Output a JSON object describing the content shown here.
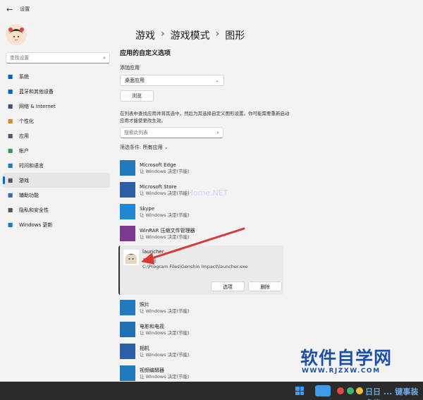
{
  "window": {
    "title": "设置",
    "back_glyph": "←"
  },
  "sidebar": {
    "search_placeholder": "查找设置",
    "items": [
      {
        "label": "系统",
        "icon": "monitor-icon",
        "color": "#0067c0"
      },
      {
        "label": "蓝牙和其他设备",
        "icon": "bluetooth-icon",
        "color": "#0067c0"
      },
      {
        "label": "网络 & Internet",
        "icon": "network-icon",
        "color": "#3b4e7a"
      },
      {
        "label": "个性化",
        "icon": "brush-icon",
        "color": "#d9822b"
      },
      {
        "label": "应用",
        "icon": "apps-icon",
        "color": "#4a5a70"
      },
      {
        "label": "帐户",
        "icon": "account-icon",
        "color": "#2e9a5c"
      },
      {
        "label": "时间和语言",
        "icon": "globe-clock-icon",
        "color": "#1f7ac0"
      },
      {
        "label": "游戏",
        "icon": "gamepad-icon",
        "color": "#555555",
        "active": true
      },
      {
        "label": "辅助功能",
        "icon": "accessibility-icon",
        "color": "#2f6fb0"
      },
      {
        "label": "隐私和安全性",
        "icon": "shield-icon",
        "color": "#555555"
      },
      {
        "label": "Windows 更新",
        "icon": "update-icon",
        "color": "#1f7ac0"
      }
    ]
  },
  "breadcrumb": [
    "游戏",
    "游戏模式",
    "图形"
  ],
  "main": {
    "section_title": "应用的自定义选项",
    "add_app_label": "添加应用",
    "dropdown_value": "桌面应用",
    "browse_label": "浏览",
    "description": "在列表中查找应用并将其选中，然后为其选择自定义图形设置。你可能需要重新启动应用才能使更改生效。",
    "list_search_placeholder": "搜索此列表",
    "filter_prefix": "筛选条件:",
    "filter_value": "所有应用"
  },
  "apps": [
    {
      "name": "Microsoft Edge",
      "status": "让 Windows 决定(节能)",
      "icon": "edge-icon",
      "color": "#1f7ac0"
    },
    {
      "name": "Microsoft Store",
      "status": "让 Windows 决定(节能)",
      "icon": "store-icon",
      "color": "#2b5fa8"
    },
    {
      "name": "Skype",
      "status": "让 Windows 决定(节能)",
      "icon": "skype-icon",
      "color": "#1e88d6"
    },
    {
      "name": "WinRAR 压缩文件管理器",
      "status": "让 Windows 决定(节能)",
      "icon": "winrar-icon",
      "color": "#7b3a8e"
    }
  ],
  "expanded_app": {
    "name": "launcher",
    "status": "高性能",
    "path": "C:\\Program Files\\Genshin Impact\\launcher.exe",
    "options_label": "选项",
    "delete_label": "删除"
  },
  "apps_after": [
    {
      "name": "照片",
      "status": "让 Windows 决定(节能)",
      "icon": "photos-icon",
      "color": "#1f7ac0"
    },
    {
      "name": "电影和电视",
      "status": "让 Windows 决定(节能)",
      "icon": "movies-icon",
      "color": "#1f6fb5"
    },
    {
      "name": "相机",
      "status": "让 Windows 决定(节能)",
      "icon": "camera-icon",
      "color": "#2b5fa8"
    },
    {
      "name": "视频编辑器",
      "status": "让 Windows 决定(节能)",
      "icon": "video-editor-icon",
      "color": "#1f7ac0"
    }
  ],
  "watermark": {
    "url_text": "WWW.RJZXW.COM",
    "brand": "软件自学网",
    "faint": "rjHome.NET",
    "taskbar_text": "日日 ... 键事装多修"
  },
  "colors": {
    "accent": "#0067c0",
    "arrow": "#d83a3a",
    "logo": "#1d50a8"
  }
}
